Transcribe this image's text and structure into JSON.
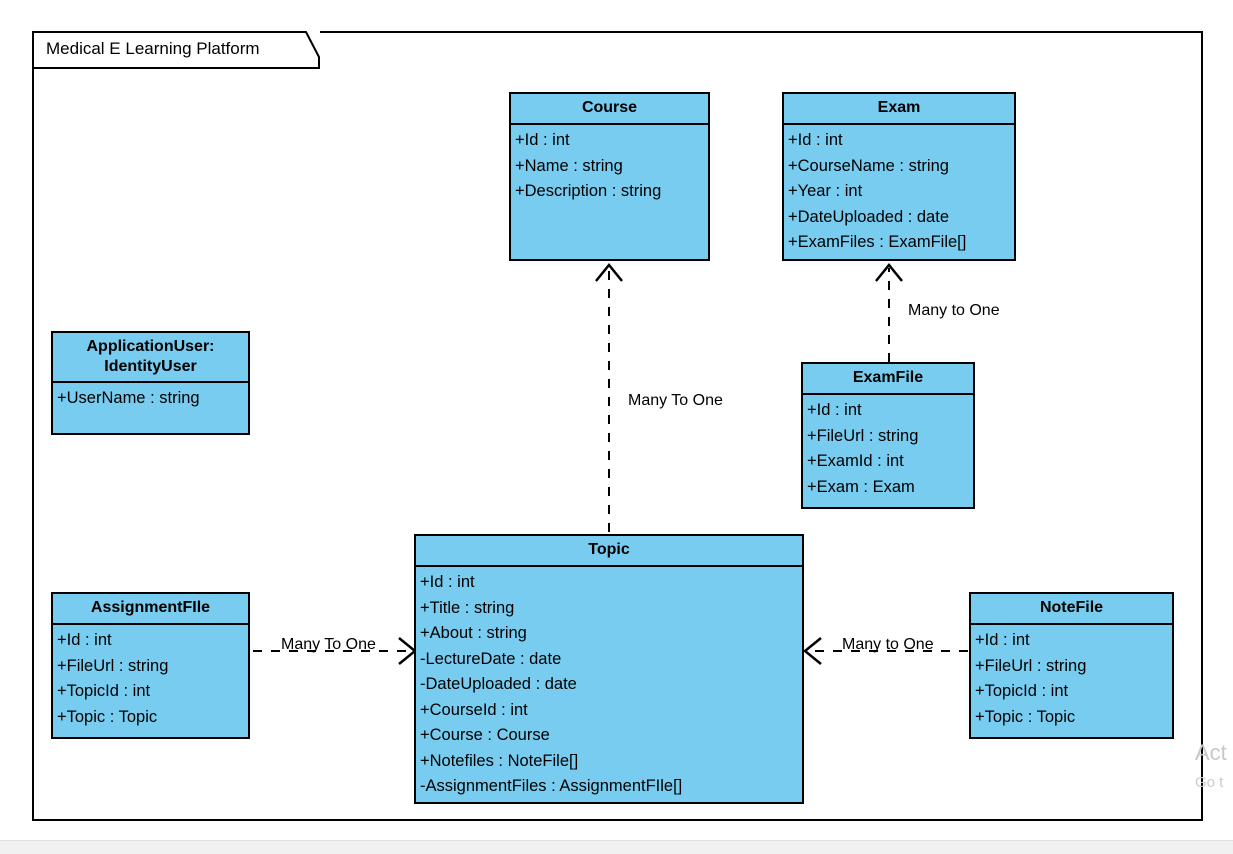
{
  "diagram": {
    "package_title": "Medical E Learning Platform",
    "type": "uml-class-diagram",
    "fill_color": "#77CCEF",
    "border_color": "#000000",
    "background_color": "#FFFFFF"
  },
  "classes": [
    {
      "id": "course",
      "name": "Course",
      "attributes": [
        "+Id : int",
        "+Name : string",
        "+Description : string"
      ]
    },
    {
      "id": "exam",
      "name": "Exam",
      "attributes": [
        "+Id : int",
        "+CourseName : string",
        "+Year : int",
        "+DateUploaded : date",
        "+ExamFiles : ExamFile[]"
      ]
    },
    {
      "id": "application-user",
      "name_line1": "ApplicationUser:",
      "name_line2": "IdentityUser",
      "attributes": [
        "+UserName : string"
      ]
    },
    {
      "id": "exam-file",
      "name": "ExamFile",
      "attributes": [
        "+Id : int",
        "+FileUrl : string",
        "+ExamId : int",
        "+Exam : Exam"
      ]
    },
    {
      "id": "topic",
      "name": "Topic",
      "attributes": [
        "+Id : int",
        "+Title : string",
        "+About : string",
        "-LectureDate : date",
        "-DateUploaded : date",
        "+CourseId : int",
        "+Course : Course",
        "+Notefiles : NoteFile[]",
        "-AssignmentFiles : AssignmentFIle[]"
      ]
    },
    {
      "id": "assignment-file",
      "name": "AssignmentFIle",
      "attributes": [
        "+Id : int",
        "+FileUrl : string",
        "+TopicId : int",
        "+Topic : Topic"
      ]
    },
    {
      "id": "note-file",
      "name": "NoteFile",
      "attributes": [
        "+Id : int",
        "+FileUrl : string",
        "+TopicId : int",
        "+Topic : Topic"
      ]
    }
  ],
  "relationships": [
    {
      "id": "topic-to-course",
      "label": "Many To One",
      "from": "topic",
      "to": "course",
      "style": "dashed",
      "arrow": "open"
    },
    {
      "id": "examfile-to-exam",
      "label": "Many to One",
      "from": "exam-file",
      "to": "exam",
      "style": "dashed",
      "arrow": "open"
    },
    {
      "id": "assignmentfile-to-topic",
      "label": "Many To One",
      "from": "assignment-file",
      "to": "topic",
      "style": "dashed",
      "arrow": "open"
    },
    {
      "id": "notefile-to-topic",
      "label": "Many to One",
      "from": "note-file",
      "to": "topic",
      "style": "dashed",
      "arrow": "open"
    }
  ],
  "watermark": {
    "line1": "Act",
    "line2": "Go t"
  }
}
